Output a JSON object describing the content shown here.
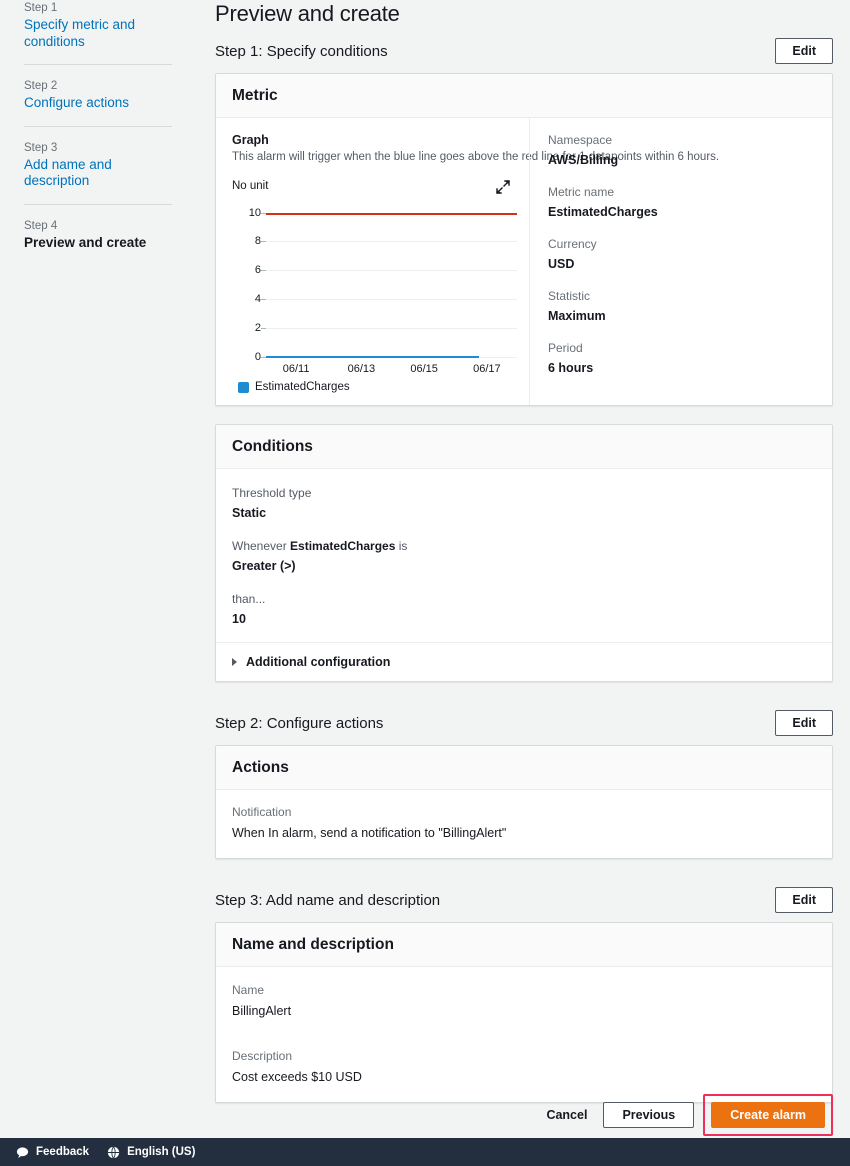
{
  "sidebar": {
    "steps": [
      {
        "num": "Step 1",
        "label": "Specify metric and conditions",
        "current": false
      },
      {
        "num": "Step 2",
        "label": "Configure actions",
        "current": false
      },
      {
        "num": "Step 3",
        "label": "Add name and description",
        "current": false
      },
      {
        "num": "Step 4",
        "label": "Preview and create",
        "current": true
      }
    ]
  },
  "page": {
    "title": "Preview and create"
  },
  "sections": {
    "step1": {
      "heading": "Step 1: Specify conditions",
      "edit_label": "Edit"
    },
    "step2": {
      "heading": "Step 2: Configure actions",
      "edit_label": "Edit"
    },
    "step3": {
      "heading": "Step 3: Add name and description",
      "edit_label": "Edit"
    }
  },
  "metric_panel": {
    "title": "Metric",
    "graph_label": "Graph",
    "graph_description": "This alarm will trigger when the blue line goes above the red line for 1 datapoints within 6 hours.",
    "expand_icon": "expand-icon",
    "details": [
      {
        "label": "Namespace",
        "value": "AWS/Billing"
      },
      {
        "label": "Metric name",
        "value": "EstimatedCharges"
      },
      {
        "label": "Currency",
        "value": "USD"
      },
      {
        "label": "Statistic",
        "value": "Maximum"
      },
      {
        "label": "Period",
        "value": "6 hours"
      }
    ]
  },
  "chart_data": {
    "type": "line",
    "title": "",
    "ylabel": "No unit",
    "xlabel": "",
    "ylim": [
      0,
      10.8
    ],
    "yticks": [
      0,
      2,
      4,
      6,
      8,
      10
    ],
    "grid": true,
    "legend": [
      "EstimatedCharges"
    ],
    "legend_position": "bottom-left",
    "x": [
      "06/11",
      "06/13",
      "06/15",
      "06/17"
    ],
    "xtick_positions_pct": [
      12,
      38,
      63,
      88
    ],
    "series": [
      {
        "name": "EstimatedCharges",
        "color": "#1f8bd1",
        "values": [
          0,
          0,
          0,
          0
        ],
        "constant_value": 0,
        "extent_pct": 85
      }
    ],
    "threshold": {
      "name": "Threshold",
      "color": "#d13212",
      "value": 10
    }
  },
  "conditions_panel": {
    "title": "Conditions",
    "threshold_type_label": "Threshold type",
    "threshold_type_value": "Static",
    "whenever_prefix": "Whenever ",
    "whenever_metric": "EstimatedCharges",
    "whenever_suffix": " is",
    "comparison_value": "Greater (>)",
    "than_label": "than...",
    "than_value": "10",
    "additional_configuration": "Additional configuration",
    "caret_icon": "caret-right-icon"
  },
  "actions_panel": {
    "title": "Actions",
    "notification_label": "Notification",
    "notification_value": "When In alarm, send a notification to \"BillingAlert\""
  },
  "name_panel": {
    "title": "Name and description",
    "name_label": "Name",
    "name_value": "BillingAlert",
    "description_label": "Description",
    "description_value": "Cost exceeds $10 USD"
  },
  "action_bar": {
    "cancel_label": "Cancel",
    "previous_label": "Previous",
    "create_label": "Create alarm",
    "highlight_color": "#ef2e5b",
    "primary_color": "#ec7211"
  },
  "footer": {
    "feedback_label": "Feedback",
    "feedback_icon": "speech-bubble-icon",
    "language_label": "English (US)",
    "language_icon": "globe-icon"
  }
}
